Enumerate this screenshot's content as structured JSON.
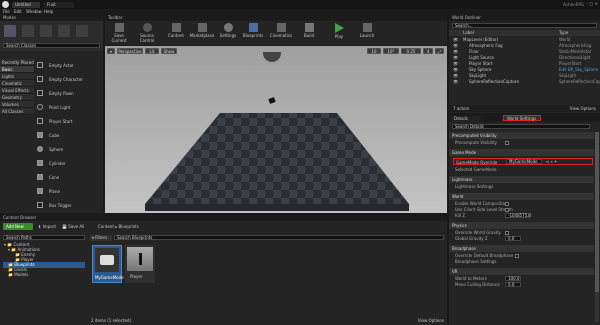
{
  "title_bar": {
    "tab_label": "Untitled",
    "tab2_label": "Fruit",
    "project": "ActionRPG"
  },
  "menu": [
    "File",
    "Edit",
    "Window",
    "Help"
  ],
  "modes": {
    "title": "Modes",
    "search_placeholder": "Search Classes",
    "categories": [
      "Recently Placed",
      "Basic",
      "Lights",
      "Cinematic",
      "Visual Effects",
      "Geometry",
      "Volumes",
      "All Classes"
    ],
    "selected_category": "Basic",
    "items": [
      "Empty Actor",
      "Empty Character",
      "Empty Pawn",
      "Point Light",
      "Player Start",
      "Cube",
      "Sphere",
      "Cylinder",
      "Cone",
      "Plane",
      "Box Trigger"
    ]
  },
  "toolbar": {
    "title": "Toolbar",
    "buttons": [
      "Save Current",
      "Source Control",
      "Content",
      "Marketplace",
      "Settings",
      "Blueprints",
      "Cinematics",
      "Build",
      "Play",
      "Launch"
    ]
  },
  "viewport": {
    "perspective": "Perspective",
    "lit": "Lit",
    "show": "Show",
    "grid": "10",
    "angle": "10°",
    "scale": "0.25",
    "cam": "4"
  },
  "world_outliner": {
    "title": "World Outliner",
    "search_placeholder": "Search...",
    "col_label": "Label",
    "col_type": "Type",
    "rows": [
      {
        "label": "MapLevel (Editor)",
        "type": "World"
      },
      {
        "label": "Atmospheric Fog",
        "type": "AtmosphericFog"
      },
      {
        "label": "Floor",
        "type": "StaticMeshActor"
      },
      {
        "label": "Light Source",
        "type": "DirectionalLight"
      },
      {
        "label": "Player Start",
        "type": "PlayerStart"
      },
      {
        "label": "Sky Sphere",
        "type": "Edit BP_Sky_Sphere"
      },
      {
        "label": "SkyLight",
        "type": "SkyLight"
      },
      {
        "label": "SphereReflectionCapture",
        "type": "SphereReflectionCapture"
      }
    ],
    "count": "7 actors",
    "view_options": "View Options"
  },
  "details": {
    "tab_details": "Details",
    "tab_world": "World Settings",
    "search_placeholder": "Search Details",
    "sections": {
      "precomputed": "Precomputed Visibility",
      "precomputed_item": "Precompute Visibility",
      "game_mode": "Game Mode",
      "gamemode_override": "GameMode Override",
      "gamemode_value": "MyGameMode",
      "selected_gamemode": "Selected GameMode",
      "lightmass": "Lightmass",
      "lightmass_settings": "Lightmass Settings",
      "world": "World",
      "enable_world_comp": "Enable World Composition",
      "use_client_side": "Use Client Side Level Stream",
      "kill_z": "Kill Z",
      "kill_z_value": "-1048575.0",
      "physics": "Physics",
      "override_gravity": "Override World Gravity",
      "global_gravity": "Global Gravity Z",
      "gravity_value": "0.0",
      "broadphase": "Broadphase",
      "override_broadphase": "Override Default Broadphase",
      "broadphase_settings": "Broadphase Settings",
      "vr": "VR",
      "world_to_meters": "World to Meters",
      "world_to_meters_value": "100.0",
      "mono_culling": "Mono Culling Distance",
      "mono_value": "0.0"
    }
  },
  "content_browser": {
    "title": "Content Browser",
    "add_new": "Add New",
    "import": "Import",
    "save_all": "Save All",
    "breadcrumb": [
      "Content",
      "Blueprints"
    ],
    "search_paths": "Search Paths",
    "filters": "Filters",
    "search_placeholder": "Search Blueprints",
    "tree": [
      "Content",
      "Animations",
      "Enemy",
      "Player",
      "Blueprints",
      "Levels",
      "Models"
    ],
    "assets": [
      {
        "name": "MyGameMode"
      },
      {
        "name": "Player"
      }
    ],
    "status": "2 items (1 selected)",
    "view_options": "View Options"
  },
  "colors": {
    "highlight_red": "#e02020",
    "accent_green": "#3b8a2e",
    "selection": "#2c5a8e",
    "play_green": "#41a343"
  }
}
